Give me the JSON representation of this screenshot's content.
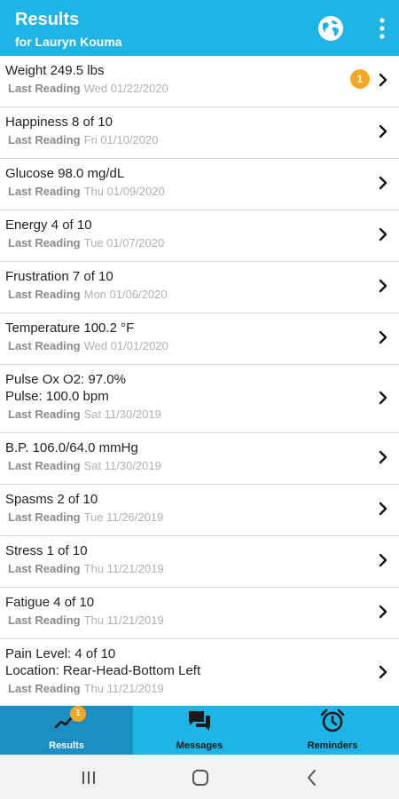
{
  "header": {
    "title": "Results",
    "subtitle": "for Lauryn Kouma"
  },
  "results": [
    {
      "lines": [
        "Weight 249.5 lbs"
      ],
      "label": "Last Reading",
      "date": "Wed 01/22/2020",
      "badge": "1"
    },
    {
      "lines": [
        "Happiness 8 of 10"
      ],
      "label": "Last Reading",
      "date": "Fri 01/10/2020"
    },
    {
      "lines": [
        "Glucose 98.0 mg/dL"
      ],
      "label": "Last Reading",
      "date": "Thu 01/09/2020"
    },
    {
      "lines": [
        "Energy 4 of 10"
      ],
      "label": "Last Reading",
      "date": "Tue 01/07/2020"
    },
    {
      "lines": [
        "Frustration 7 of 10"
      ],
      "label": "Last Reading",
      "date": "Mon 01/06/2020"
    },
    {
      "lines": [
        "Temperature 100.2 °F"
      ],
      "label": "Last Reading",
      "date": "Wed 01/01/2020"
    },
    {
      "lines": [
        "Pulse Ox O2: 97.0%",
        "Pulse: 100.0 bpm"
      ],
      "label": "Last Reading",
      "date": "Sat 11/30/2019"
    },
    {
      "lines": [
        "B.P. 106.0/64.0 mmHg"
      ],
      "label": "Last Reading",
      "date": "Sat 11/30/2019"
    },
    {
      "lines": [
        "Spasms 2 of 10"
      ],
      "label": "Last Reading",
      "date": "Tue 11/26/2019"
    },
    {
      "lines": [
        "Stress 1 of 10"
      ],
      "label": "Last Reading",
      "date": "Thu 11/21/2019"
    },
    {
      "lines": [
        "Fatigue 4 of 10"
      ],
      "label": "Last Reading",
      "date": "Thu 11/21/2019"
    },
    {
      "lines": [
        "Pain Level: 4 of 10",
        "Location: Rear-Head-Bottom Left"
      ],
      "label": "Last Reading",
      "date": "Thu 11/21/2019"
    }
  ],
  "tabs": [
    {
      "label": "Results",
      "icon": "chart-line-icon",
      "badge": "1",
      "active": true
    },
    {
      "label": "Messages",
      "icon": "chat-bubbles-icon",
      "active": false
    },
    {
      "label": "Reminders",
      "icon": "alarm-clock-icon",
      "active": false
    }
  ],
  "colors": {
    "primary": "#1EB4E6",
    "active_tab": "#1B8FC4",
    "badge": "#F7A823"
  },
  "system_nav": [
    "recent-apps-icon",
    "home-icon",
    "back-icon"
  ]
}
